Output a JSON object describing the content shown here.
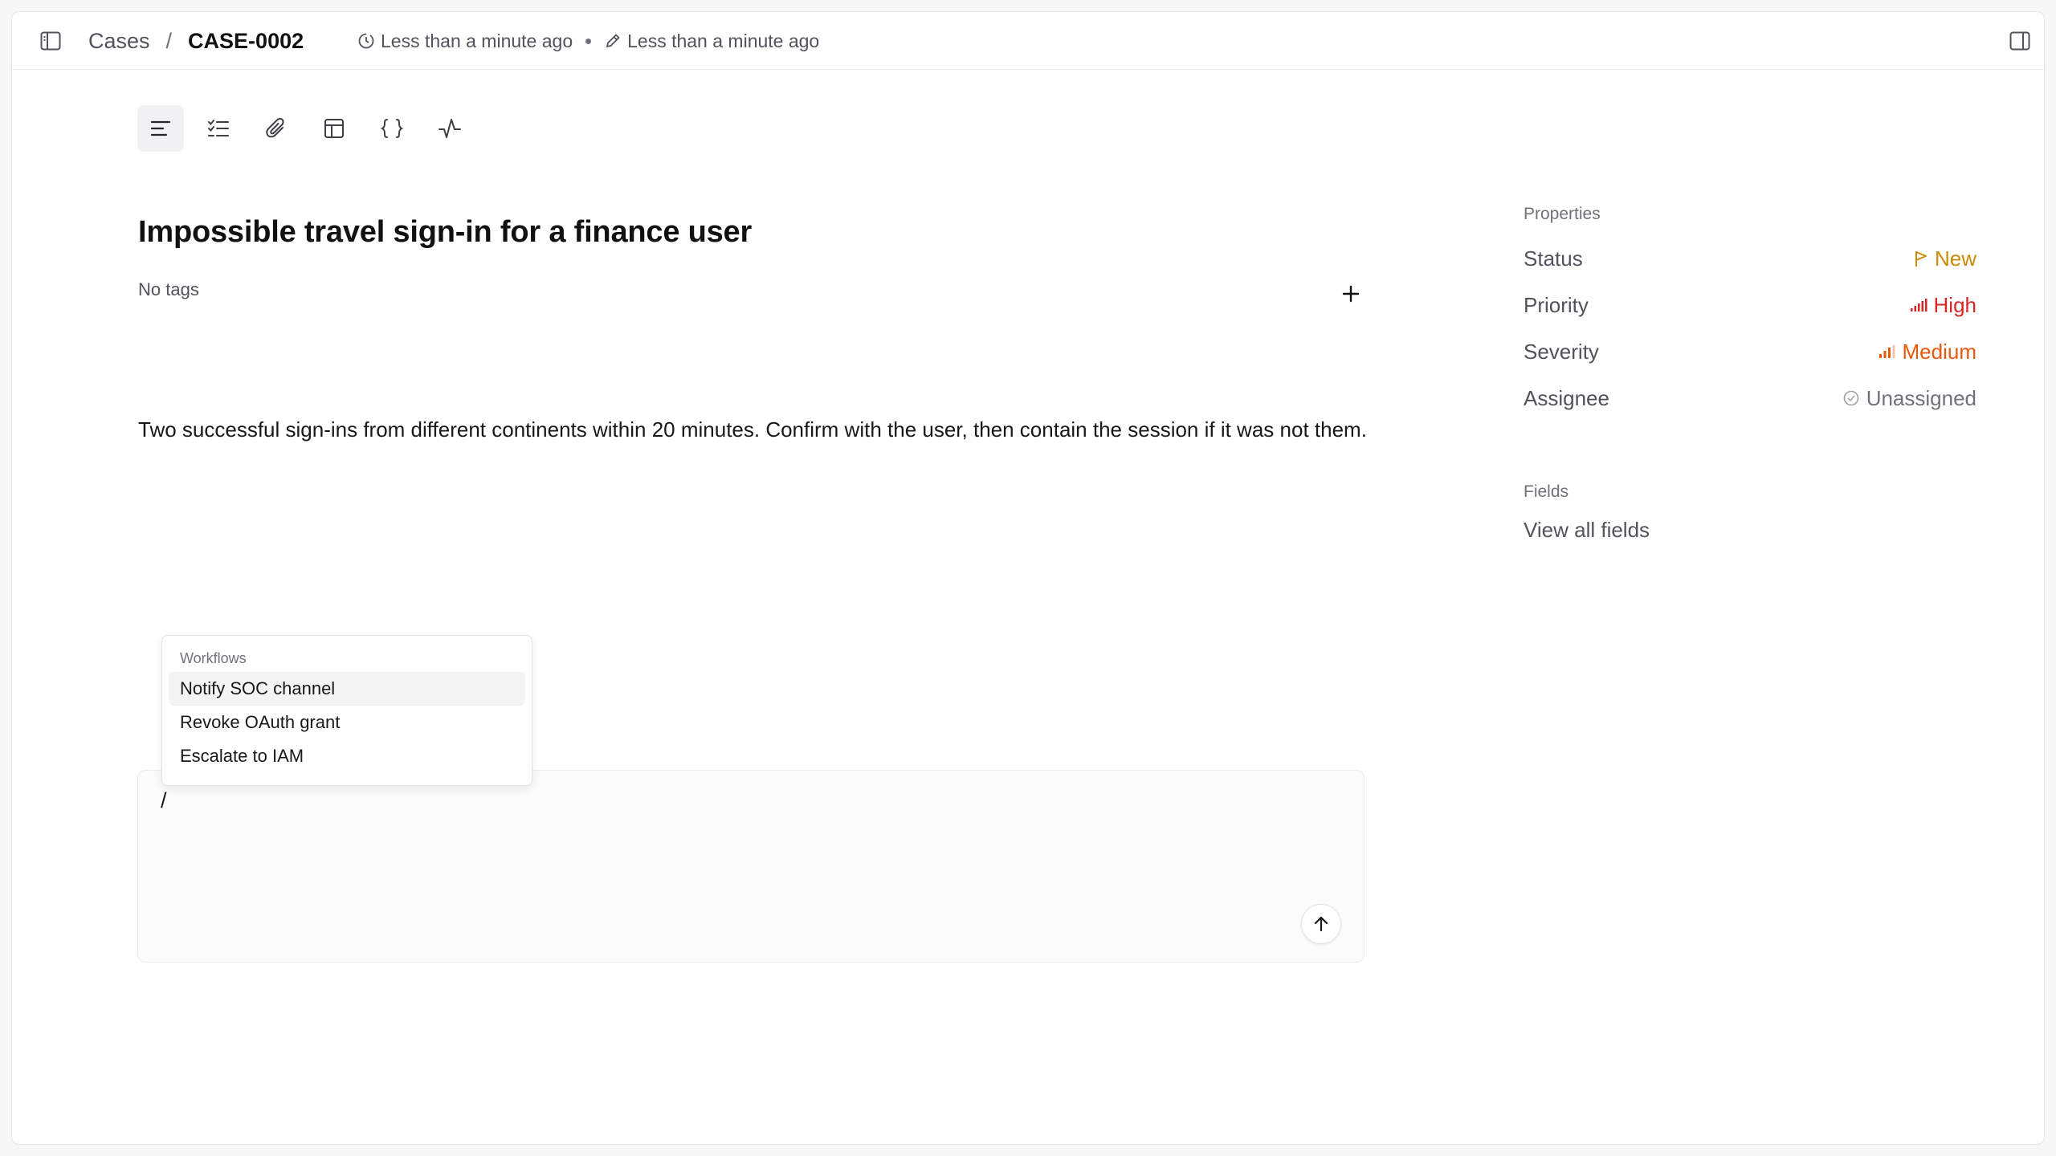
{
  "header": {
    "breadcrumb_parent": "Cases",
    "breadcrumb_separator": "/",
    "breadcrumb_current": "CASE-0002",
    "created": "Less than a minute ago",
    "updated": "Less than a minute ago"
  },
  "toolbar": {
    "tools": [
      "summary-icon",
      "checklist-icon",
      "attachment-icon",
      "table-icon",
      "braces-icon",
      "activity-icon"
    ],
    "active": "summary-icon"
  },
  "case": {
    "title": "Impossible travel sign-in for a finance user",
    "tags_label": "No tags",
    "description": "Two successful sign-ins from different continents within 20 minutes. Confirm with the user, then contain the session if it was not them."
  },
  "menu": {
    "header": "Workflows",
    "items": [
      "Notify SOC channel",
      "Revoke OAuth grant",
      "Escalate to IAM"
    ]
  },
  "composer": {
    "value": "/"
  },
  "properties": {
    "label": "Properties",
    "status": {
      "name": "Status",
      "value": "New",
      "color": "#ca8a04"
    },
    "priority": {
      "name": "Priority",
      "value": "High",
      "color": "#dc2626"
    },
    "severity": {
      "name": "Severity",
      "value": "Medium",
      "color": "#ea580c"
    },
    "assignee": {
      "name": "Assignee",
      "value": "Unassigned",
      "color": "#71717a"
    }
  },
  "fields": {
    "label": "Fields",
    "view_all": "View all fields"
  }
}
